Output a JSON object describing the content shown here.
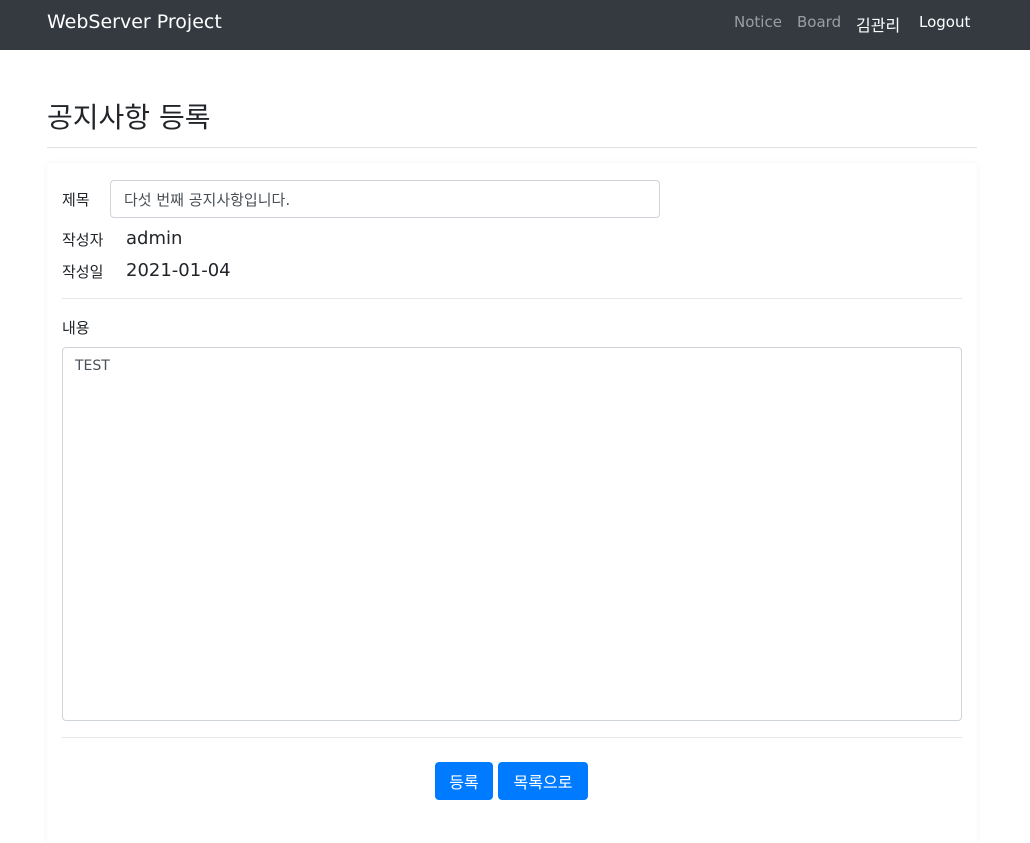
{
  "navbar": {
    "brand": "WebServer Project",
    "links": {
      "notice": "Notice",
      "board": "Board",
      "user": "김관리",
      "logout": "Logout"
    }
  },
  "page": {
    "title": "공지사항 등록"
  },
  "form": {
    "title_label": "제목",
    "title_value": "다섯 번째 공지사항입니다.",
    "author_label": "작성자",
    "author_value": "admin",
    "date_label": "작성일",
    "date_value": "2021-01-04",
    "content_label": "내용",
    "content_value": "TEST"
  },
  "actions": {
    "submit_label": "등록",
    "list_label": "목록으로"
  },
  "colors": {
    "navbar_bg": "#343a40",
    "primary": "#007bff"
  }
}
